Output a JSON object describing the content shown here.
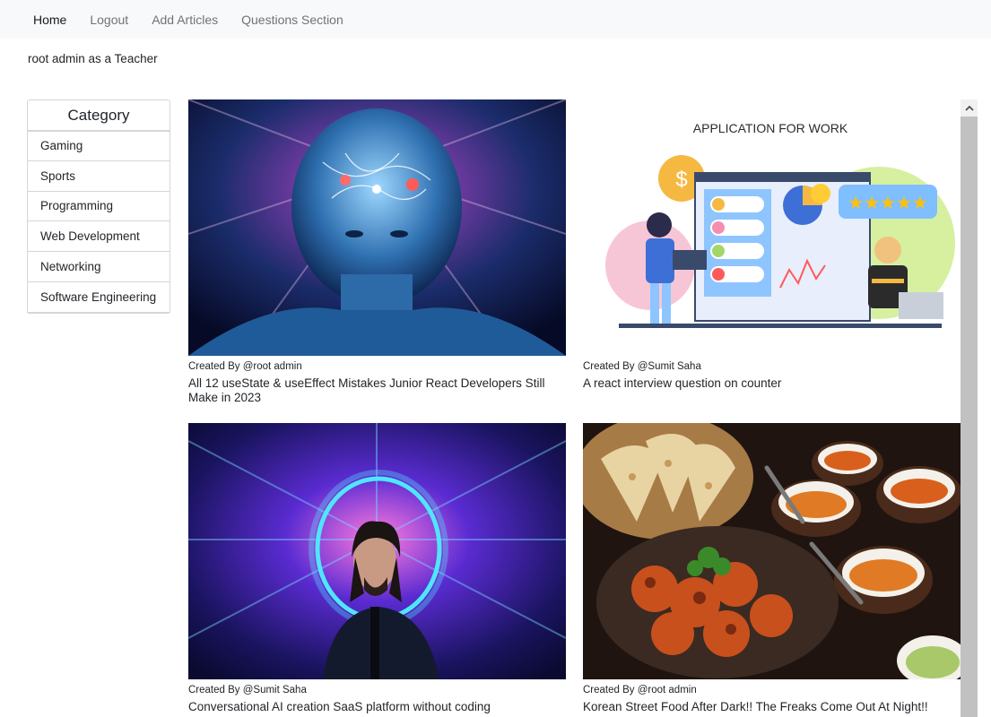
{
  "nav": {
    "items": [
      {
        "label": "Home",
        "active": true
      },
      {
        "label": "Logout",
        "active": false
      },
      {
        "label": "Add Articles",
        "active": false
      },
      {
        "label": "Questions Section",
        "active": false
      }
    ]
  },
  "user": {
    "status": "root admin as a Teacher"
  },
  "category": {
    "title": "Category",
    "items": [
      "Gaming",
      "Sports",
      "Programming",
      "Web Development",
      "Networking",
      "Software Engineering"
    ]
  },
  "articles": [
    {
      "author": "Created By @root admin",
      "title": "All 12 useState & useEffect Mistakes Junior React Developers Still Make in 2023",
      "image": "glowing-brain-head"
    },
    {
      "author": "Created By @Sumit Saha",
      "title": "A react interview question on counter",
      "image": "application-for-work-illustration",
      "image_caption": "APPLICATION FOR WORK"
    },
    {
      "author": "Created By @Sumit Saha",
      "title": "Conversational AI creation SaaS platform without coding",
      "image": "neon-portrait"
    },
    {
      "author": "Created By @root admin",
      "title": "Korean Street Food After Dark!! The Freaks Come Out At Night!!",
      "image": "street-food-platter"
    }
  ],
  "colors": {
    "navbar_bg": "#f8f9fa",
    "scrollbar_thumb": "#c1c1c1"
  },
  "icons": {
    "scroll_up": "chevron-up-icon"
  }
}
